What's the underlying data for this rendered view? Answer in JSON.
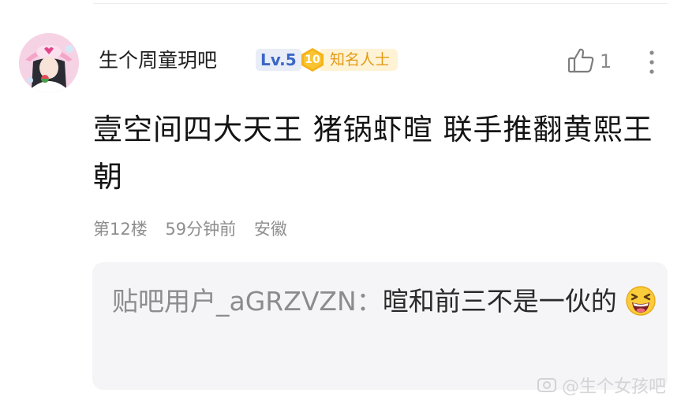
{
  "post": {
    "username": "生个周童玥吧",
    "level": "Lv.5",
    "title_badge": {
      "number": "10",
      "label": "知名人士"
    },
    "like_count": "1",
    "content": "壹空间四大天王 猪锅虾暄 联手推翻黄熙王朝",
    "floor": "第12楼",
    "time": "59分钟前",
    "location": "安徽"
  },
  "reply": {
    "user": "贴吧用户_aGRZVZN：",
    "text": "暄和前三不是一伙的"
  },
  "watermark": {
    "text": "@生个女孩吧"
  },
  "icons": {
    "avatar": "avatar",
    "like": "thumbs-up-icon",
    "more": "more-vertical-icon",
    "medal": "medal-icon",
    "emoji": "grinning-squint-emoji"
  },
  "colors": {
    "level_badge": "#3b67c7",
    "title_badge": "#e49a14",
    "meta_text": "#8e8e8e",
    "reply_bg": "#f5f5f7"
  }
}
